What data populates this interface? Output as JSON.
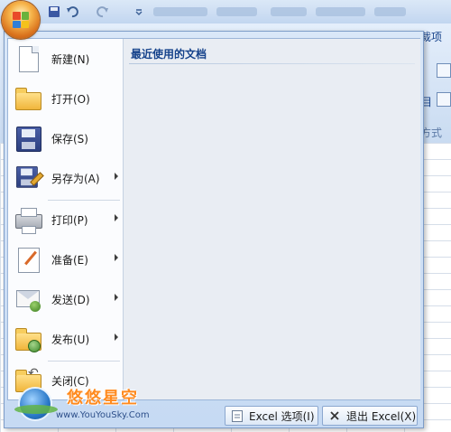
{
  "ribbon": {
    "right_tab_label": "裁项",
    "group_label_fragment": "方式"
  },
  "quick_access": {
    "save_icon": "save-icon",
    "undo_icon": "undo-icon",
    "redo_icon": "redo-icon",
    "customize_icon": "dropdown-icon"
  },
  "office_button": {
    "icon": "office-logo-icon"
  },
  "office_menu": {
    "items": [
      {
        "label": "新建(N)",
        "icon": "new-document-icon",
        "submenu": false
      },
      {
        "label": "打开(O)",
        "icon": "open-folder-icon",
        "submenu": false
      },
      {
        "label": "保存(S)",
        "icon": "save-floppy-icon",
        "submenu": false
      },
      {
        "label": "另存为(A)",
        "icon": "save-as-icon",
        "submenu": true
      },
      {
        "label": "打印(P)",
        "icon": "printer-icon",
        "submenu": true
      },
      {
        "label": "准备(E)",
        "icon": "prepare-icon",
        "submenu": true
      },
      {
        "label": "发送(D)",
        "icon": "send-icon",
        "submenu": true
      },
      {
        "label": "发布(U)",
        "icon": "publish-icon",
        "submenu": true
      },
      {
        "label": "关闭(C)",
        "icon": "close-folder-icon",
        "submenu": false
      }
    ],
    "recent_title": "最近使用的文档",
    "options_button": "Excel 选项(I)",
    "exit_button": "退出 Excel(X)"
  },
  "watermark": {
    "name": "悠悠星空",
    "url": "www.YouYouSky.Com"
  }
}
